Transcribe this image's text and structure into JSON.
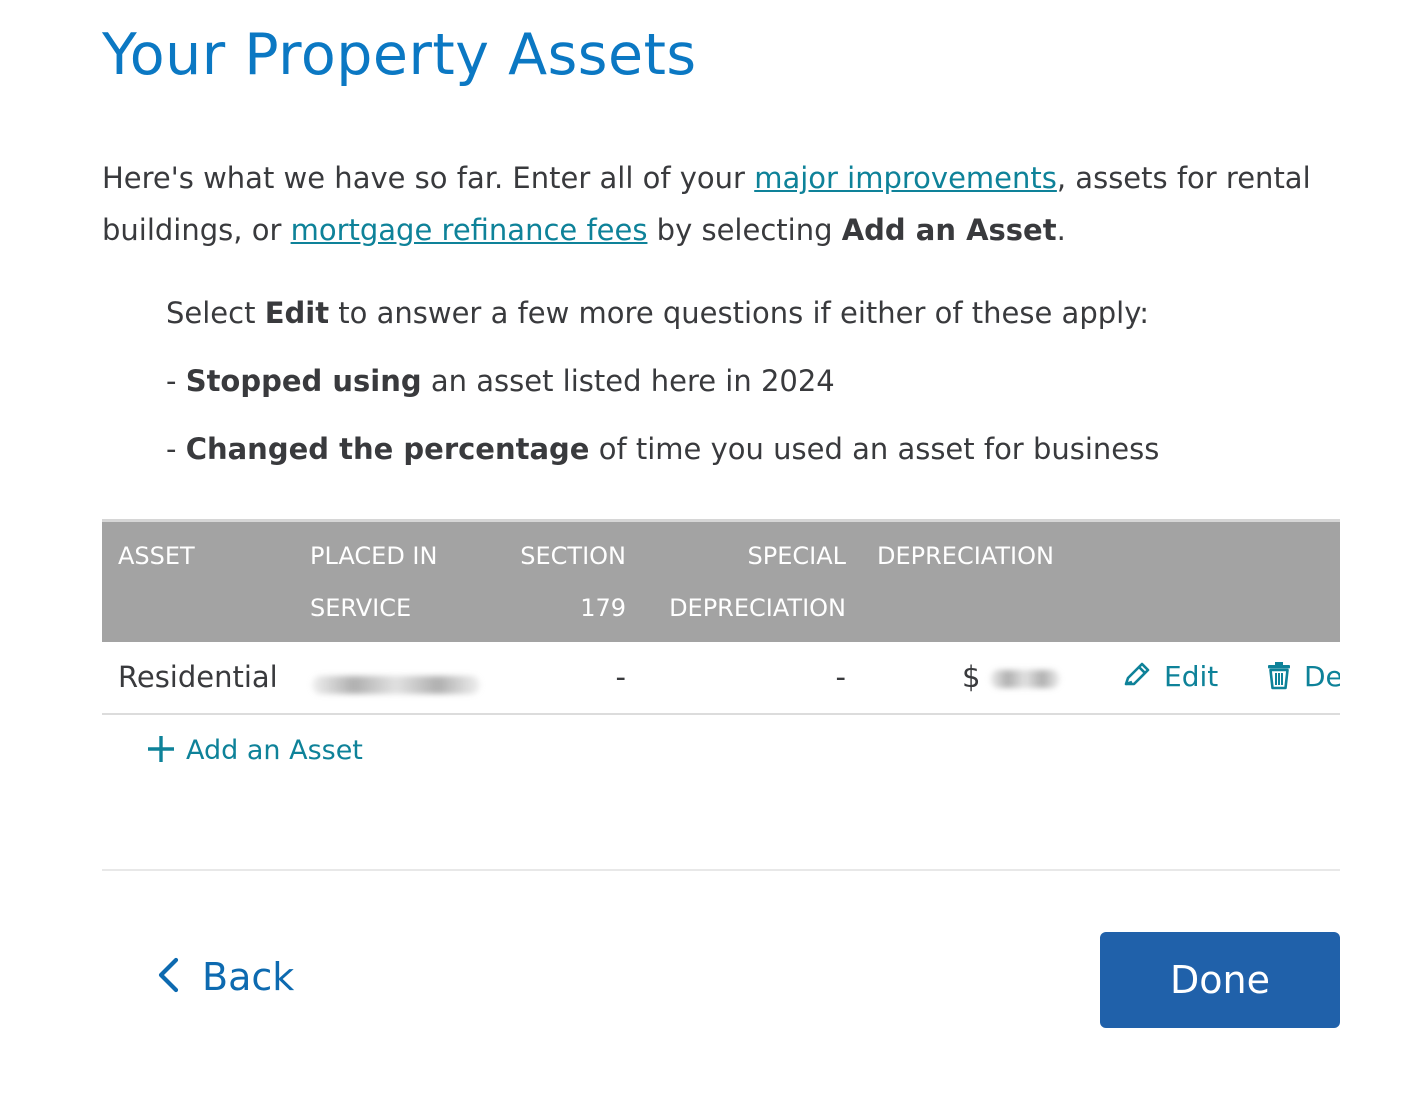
{
  "page": {
    "title": "Your Property Assets",
    "intro": {
      "text1": "Here's what we have so far. Enter all of your ",
      "link1": "major improvements",
      "text2": ", assets for rental buildings, or ",
      "link2": "mortgage refinance fees",
      "text3": " by selecting ",
      "bold": "Add an Asset",
      "text4": "."
    },
    "edit_note": {
      "line1_pre": "Select ",
      "line1_bold": "Edit",
      "line1_post": " to answer a few more questions if either of these apply:",
      "line2_pre": "- ",
      "line2_bold": "Stopped using",
      "line2_post": " an asset listed here in 2024",
      "line3_pre": "- ",
      "line3_bold": "Changed the percentage",
      "line3_post": " of time you used an asset for business"
    }
  },
  "table": {
    "headers": {
      "asset": "ASSET",
      "placed_line1": "PLACED IN",
      "placed_line2": "SERVICE",
      "section_line1": "SECTION",
      "section_line2": "179",
      "special_line1": "SPECIAL",
      "special_line2": "DEPRECIATION",
      "depreciation": "DEPRECIATION"
    },
    "rows": [
      {
        "asset": "Residential",
        "section179": "-",
        "special": "-",
        "depreciation_prefix": "$",
        "edit_label": "Edit",
        "delete_label": "De"
      }
    ]
  },
  "add_asset_label": "Add an Asset",
  "nav": {
    "back_label": "Back",
    "done_label": "Done"
  },
  "colors": {
    "title": "#0b78c3",
    "link": "#0e8299",
    "header_bg": "#a3a3a3",
    "done_bg": "#2061aa"
  }
}
